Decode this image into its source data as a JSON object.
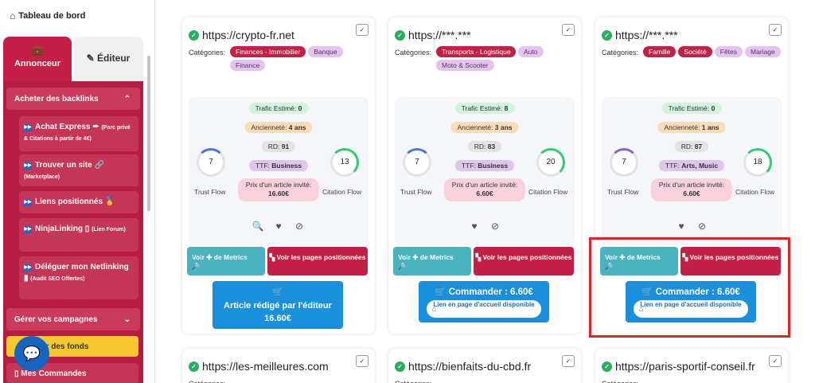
{
  "sidebar": {
    "dashboard": "Tableau de bord",
    "tab_advertiser": "Annonceur",
    "tab_editor": "Éditeur",
    "section_buy": "Acheter des backlinks",
    "items": [
      {
        "label": "Achat Express",
        "emoji": "✒",
        "note": "(Parc privé & Citations à partir de 4€)"
      },
      {
        "label": "Trouver un site",
        "emoji": "🔗",
        "note": "(Marketplace)"
      },
      {
        "label": "Liens positionnés",
        "emoji": "🥇",
        "note": ""
      },
      {
        "label": "NinjaLinking",
        "emoji": "▯",
        "note": "(Lien Forum)"
      },
      {
        "label": "Déléguer mon Netlinking",
        "emoji": "▮",
        "note": "(Audit SEO Offertes)"
      }
    ],
    "section_campaigns": "Gérer vos campagnes",
    "funds": "er des fonds",
    "orders": "Mes Commandes"
  },
  "common": {
    "categories": "Catégories:",
    "traffic": "Trafic Estimé:",
    "age": "Ancienneté:",
    "rd": "RD:",
    "ttf": "TTF:",
    "price_label": "Prix d'un article invité:",
    "trust_flow": "Trust Flow",
    "citation_flow": "Citation Flow",
    "metrics_btn": "Voir ✚ de Metrics",
    "pages_btn": "Voir les pages positionnées",
    "home_link": "Lien en page d'accueil disponible",
    "check": "✓"
  },
  "cards": [
    {
      "site": "https://crypto-fr.net",
      "tags": [
        {
          "label": "Finances - Immobilier",
          "style": "red"
        },
        {
          "label": "Banque",
          "style": "lav"
        },
        {
          "label": "Finance",
          "style": "lav"
        }
      ],
      "traffic": "0",
      "age": "4 ans",
      "rd": "91",
      "ttf": "Business",
      "price": "16.60€",
      "trust": "7",
      "citation": "13",
      "order_title": "Article rédigé par l'éditeur",
      "order_price": "16.60€",
      "icons": [
        "search-icon",
        "heart-icon",
        "block-icon"
      ]
    },
    {
      "site": "https://***.***",
      "tags": [
        {
          "label": "Transports - Logistique",
          "style": "red"
        },
        {
          "label": "Auto",
          "style": "lav"
        },
        {
          "label": "Moto & Scooter",
          "style": "lav"
        }
      ],
      "traffic": "8",
      "age": "3 ans",
      "rd": "83",
      "ttf": "Business",
      "price": "6.60€",
      "trust": "7",
      "citation": "20",
      "order_title": "Commander : 6.60€",
      "icons": [
        "heart-icon",
        "block-icon"
      ]
    },
    {
      "site": "https://***.***",
      "tags": [
        {
          "label": "Famille",
          "style": "red"
        },
        {
          "label": "Société",
          "style": "red"
        },
        {
          "label": "Fêtes",
          "style": "lav"
        },
        {
          "label": "Mariage",
          "style": "lav"
        }
      ],
      "traffic": "0",
      "age": "1 ans",
      "rd": "87",
      "ttf": "Arts, Music",
      "price": "6.60€",
      "trust": "7",
      "citation": "18",
      "order_title": "Commander : 6.60€",
      "icons": [
        "heart-icon",
        "block-icon"
      ]
    }
  ],
  "bottom_cards": [
    {
      "site": "https://les-meilleures.com"
    },
    {
      "site": "https://bienfaits-du-cbd.fr"
    },
    {
      "site": "https://paris-sportif-conseil.fr"
    }
  ]
}
